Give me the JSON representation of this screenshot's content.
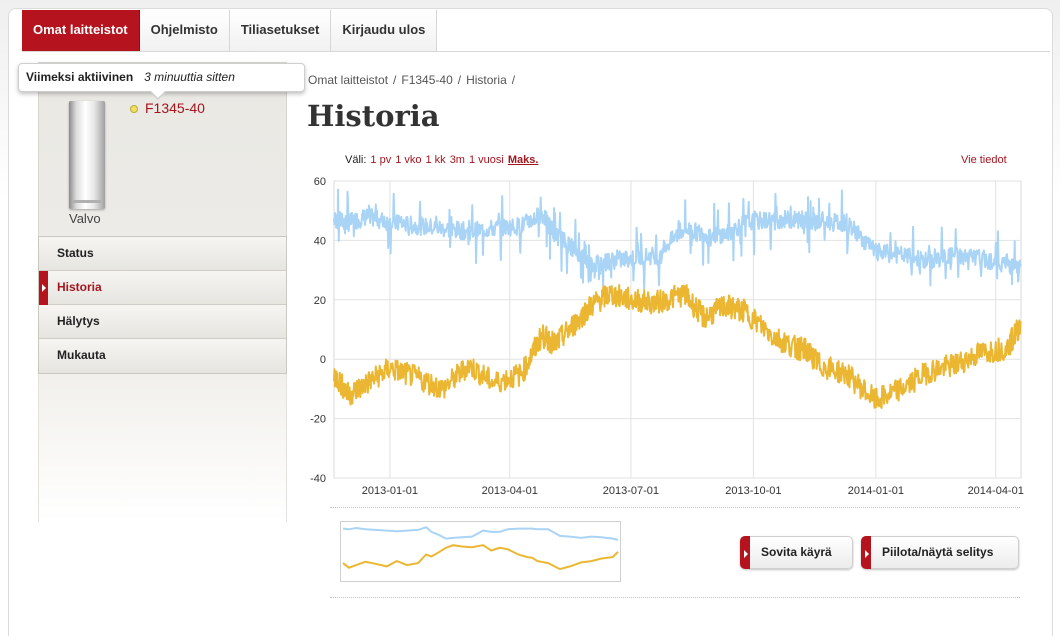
{
  "nav": {
    "items": [
      {
        "label": "Omat laitteistot",
        "active": true
      },
      {
        "label": "Ohjelmisto",
        "active": false
      },
      {
        "label": "Tiliasetukset",
        "active": false
      },
      {
        "label": "Kirjaudu ulos",
        "active": false
      }
    ]
  },
  "tooltip": {
    "label": "Viimeksi aktiivinen",
    "value": "3 minuuttia sitten"
  },
  "device": {
    "name": "F1345-40",
    "image_label": "Valvo",
    "status_color": "#f2df61"
  },
  "sidebar": {
    "items": [
      {
        "label": "Status",
        "active": false
      },
      {
        "label": "Historia",
        "active": true
      },
      {
        "label": "Hälytys",
        "active": false
      },
      {
        "label": "Mukauta",
        "active": false
      }
    ]
  },
  "breadcrumb": {
    "items": [
      "Omat laitteistot",
      "F1345-40",
      "Historia"
    ],
    "separator": "/"
  },
  "page": {
    "title": "Historia"
  },
  "range": {
    "label": "Väli:",
    "options": [
      "1 pv",
      "1 vko",
      "1 kk",
      "3m",
      "1 vuosi",
      "Maks."
    ],
    "selected": "Maks."
  },
  "export": {
    "label": "Vie tiedot"
  },
  "buttons": {
    "fit": "Sovita käyrä",
    "legend": "Piilota/näytä selitys"
  },
  "colors": {
    "accent": "#b5141f",
    "series_upper": "#a9d4f5",
    "series_lower": "#ebb732"
  },
  "chart_data": {
    "type": "line",
    "title": "",
    "xlabel": "",
    "ylabel": "",
    "ylim": [
      -40,
      60
    ],
    "yticks": [
      60,
      40,
      20,
      0,
      -20,
      -40
    ],
    "xlim": [
      "2012-11-20",
      "2014-04-20"
    ],
    "xticks": [
      "2013-01-01",
      "2013-04-01",
      "2013-07-01",
      "2013-10-01",
      "2014-01-01",
      "2014-04-01"
    ],
    "grid": true,
    "legend": "hidden",
    "series": [
      {
        "color": "#a9d4f5",
        "x": [
          "2012-11-20",
          "2012-12-01",
          "2012-12-15",
          "2013-01-01",
          "2013-01-20",
          "2013-02-10",
          "2013-03-01",
          "2013-03-20",
          "2013-04-10",
          "2013-04-25",
          "2013-05-05",
          "2013-05-20",
          "2013-06-01",
          "2013-06-15",
          "2013-07-01",
          "2013-07-20",
          "2013-08-10",
          "2013-08-25",
          "2013-09-10",
          "2013-09-25",
          "2013-10-15",
          "2013-11-01",
          "2013-11-10",
          "2013-11-20",
          "2013-12-10",
          "2014-01-01",
          "2014-01-20",
          "2014-02-10",
          "2014-03-01",
          "2014-03-20",
          "2014-04-10",
          "2014-04-20"
        ],
        "y": [
          47,
          46,
          48,
          46,
          45,
          44,
          43,
          44,
          45,
          49,
          42,
          37,
          32,
          33,
          34,
          35,
          44,
          42,
          42,
          46,
          47,
          47,
          47,
          46,
          46,
          36,
          35,
          33,
          35,
          34,
          32,
          30
        ]
      },
      {
        "color": "#ebb732",
        "x": [
          "2012-11-20",
          "2012-12-01",
          "2012-12-15",
          "2013-01-01",
          "2013-01-20",
          "2013-02-10",
          "2013-03-01",
          "2013-03-20",
          "2013-04-10",
          "2013-04-25",
          "2013-05-05",
          "2013-05-20",
          "2013-06-01",
          "2013-06-15",
          "2013-07-01",
          "2013-07-20",
          "2013-08-10",
          "2013-08-25",
          "2013-09-10",
          "2013-09-25",
          "2013-10-15",
          "2013-11-01",
          "2013-11-10",
          "2013-11-20",
          "2013-12-10",
          "2014-01-01",
          "2014-01-20",
          "2014-02-10",
          "2014-03-01",
          "2014-03-20",
          "2014-04-10",
          "2014-04-20"
        ],
        "y": [
          -5,
          -12,
          -8,
          -3,
          -6,
          -10,
          -2,
          -8,
          -5,
          8,
          5,
          12,
          18,
          22,
          20,
          19,
          22,
          14,
          18,
          16,
          8,
          4,
          3,
          -2,
          -5,
          -14,
          -10,
          -4,
          -2,
          2,
          4,
          12
        ]
      }
    ]
  }
}
